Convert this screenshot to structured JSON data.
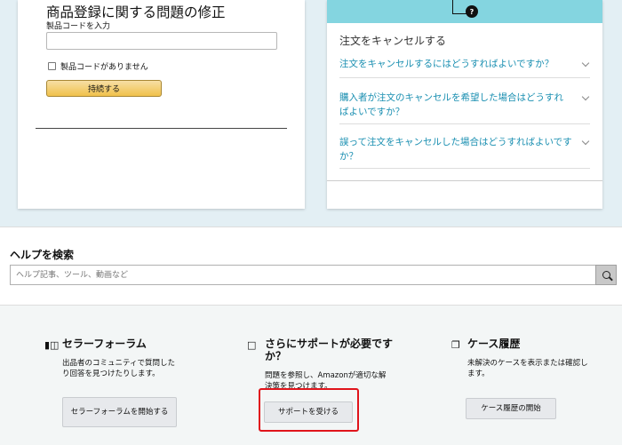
{
  "product_fix": {
    "title": "商品登録に関する問題の修正",
    "code_label": "製品コードを入力",
    "code_value": "",
    "no_code_label": "製品コードがありません",
    "continue_button": "持続する"
  },
  "cancel_panel": {
    "badge": "?",
    "title": "注文をキャンセルする",
    "faqs": [
      "注文をキャンセルするにはどうすればよいですか？",
      "購入者が注文のキャンセルを希望した場合はどうすればよいですか？",
      "誤って注文をキャンセルした場合はどうすればよいですか？"
    ]
  },
  "help_search": {
    "title": "ヘルプを検索",
    "placeholder": "ヘルプ記事、ツール、動画など"
  },
  "support": {
    "forum": {
      "icon": "forum-icon",
      "title": "セラーフォーラム",
      "description": "出品者のコミュニティで質問したり回答を見つけたりします。",
      "button": "セラーフォーラムを開始する"
    },
    "more_help": {
      "icon": "speech-bubble-icon",
      "title": "さらにサポートが必要ですか？",
      "description": "問題を参照し、Amazonが適切な解決策を見つけます。",
      "button": "サポートを受ける"
    },
    "case_log": {
      "icon": "copy-icon",
      "title": "ケース履歴",
      "description": "未解決のケースを表示または確認します。",
      "button": "ケース履歴の開始"
    }
  },
  "colors": {
    "accent_link": "#1a8fb1",
    "hero_band": "#84d5e0",
    "highlight": "#e0141b",
    "primary_button": "#f0c14b"
  }
}
